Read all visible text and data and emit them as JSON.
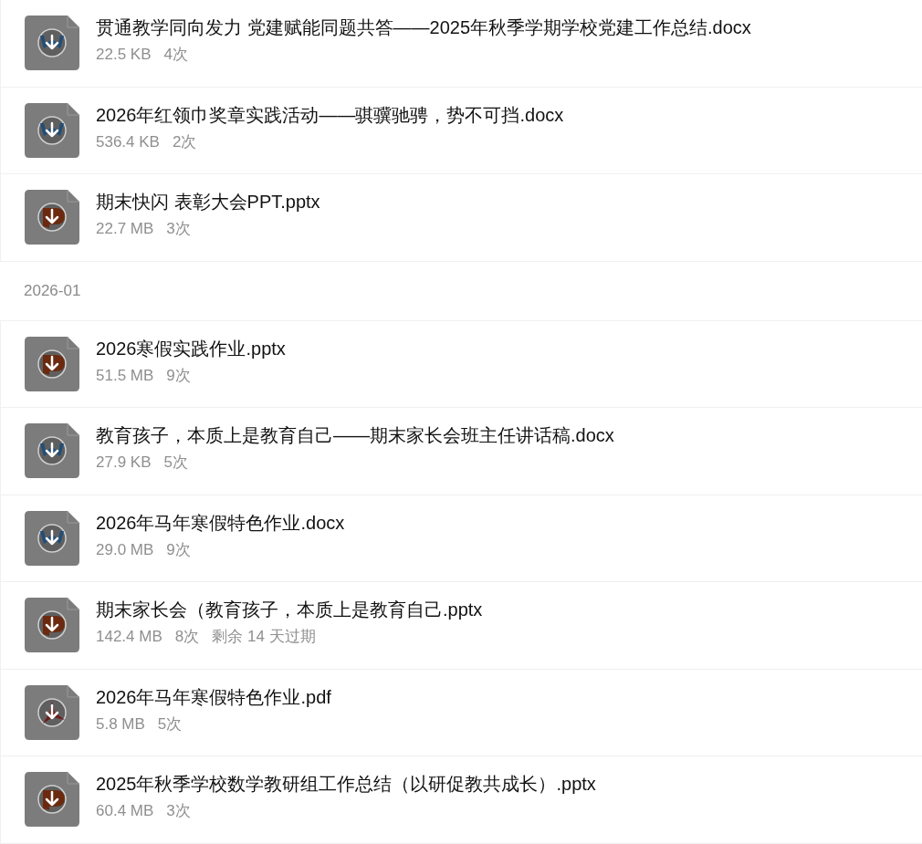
{
  "sections": [
    {
      "files": [
        {
          "kind": "docx",
          "name": "贯通教学同向发力 党建赋能同题共答——2025年秋季学期学校党建工作总结.docx",
          "size": "22.5 KB",
          "count": "4次"
        },
        {
          "kind": "docx",
          "name": "2026年红领巾奖章实践活动——骐骥驰骋，势不可挡.docx",
          "size": "536.4 KB",
          "count": "2次"
        },
        {
          "kind": "pptx",
          "name": "期末快闪 表彰大会PPT.pptx",
          "size": "22.7 MB",
          "count": "3次"
        }
      ]
    },
    {
      "date": "2026-01",
      "files": [
        {
          "kind": "pptx",
          "name": "2026寒假实践作业.pptx",
          "size": "51.5 MB",
          "count": "9次"
        },
        {
          "kind": "docx",
          "name": "教育孩子，本质上是教育自己——期末家长会班主任讲话稿.docx",
          "size": "27.9 KB",
          "count": "5次"
        },
        {
          "kind": "docx",
          "name": "2026年马年寒假特色作业.docx",
          "size": "29.0 MB",
          "count": "9次"
        },
        {
          "kind": "pptx",
          "name": "期末家长会（教育孩子，本质上是教育自己.pptx",
          "size": "142.4 MB",
          "count": "8次",
          "expiry": "剩余 14 天过期"
        },
        {
          "kind": "pdf",
          "name": "2026年马年寒假特色作业.pdf",
          "size": "5.8 MB",
          "count": "5次"
        },
        {
          "kind": "pptx",
          "name": "2025年秋季学校数学教研组工作总结（以研促教共成长）.pptx",
          "size": "60.4 MB",
          "count": "3次"
        }
      ]
    }
  ]
}
